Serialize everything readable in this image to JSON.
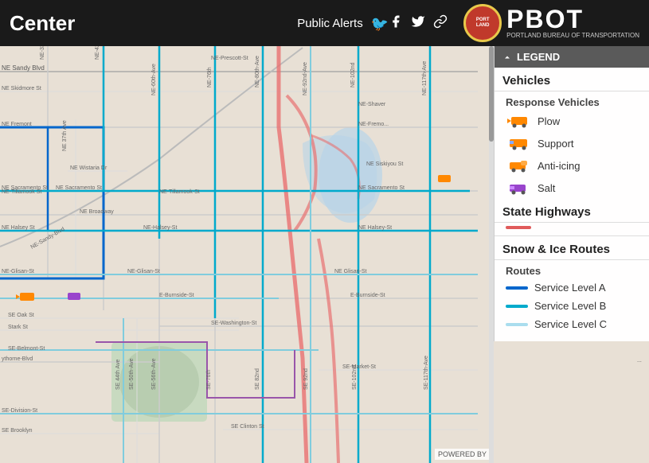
{
  "header": {
    "title": "Center",
    "public_alerts_label": "Public Alerts",
    "social_icons": [
      "facebook",
      "twitter",
      "link"
    ],
    "pbot_big": "PBOT",
    "pbot_small": "PORTLAND BUREAU OF TRANSPORTATION"
  },
  "legend": {
    "header_label": "LEGEND",
    "sections": [
      {
        "title": "Vehicles",
        "subsections": [
          {
            "title": "Response Vehicles",
            "items": [
              {
                "label": "Plow",
                "icon": "plow"
              },
              {
                "label": "Support",
                "icon": "support"
              },
              {
                "label": "Anti-icing",
                "icon": "anti-icing"
              },
              {
                "label": "Salt",
                "icon": "salt"
              }
            ]
          }
        ]
      },
      {
        "title": "State Highways",
        "items": []
      },
      {
        "title": "Snow & Ice Routes",
        "subsections": [
          {
            "title": "Routes",
            "items": [
              {
                "label": "Service Level A",
                "line_class": "route-level-a"
              },
              {
                "label": "Service Level B",
                "line_class": "route-level-b"
              },
              {
                "label": "Service Level C",
                "line_class": "route-level-c"
              }
            ]
          }
        ]
      }
    ],
    "powered_by": "POWERED BY"
  },
  "map": {
    "background_color": "#e8e0d5"
  }
}
